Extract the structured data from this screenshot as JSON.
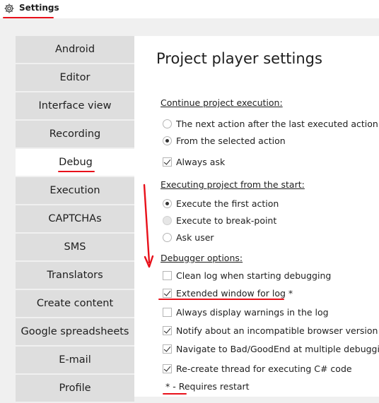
{
  "window": {
    "title": "Settings",
    "icon": "gear-icon"
  },
  "sidebar": {
    "items": [
      {
        "label": "Android"
      },
      {
        "label": "Editor"
      },
      {
        "label": "Interface view"
      },
      {
        "label": "Recording"
      },
      {
        "label": "Debug",
        "active": true
      },
      {
        "label": "Execution"
      },
      {
        "label": "CAPTCHAs"
      },
      {
        "label": "SMS"
      },
      {
        "label": "Translators"
      },
      {
        "label": "Create content"
      },
      {
        "label": "Google spreadsheets"
      },
      {
        "label": "E-mail"
      },
      {
        "label": "Profile"
      }
    ]
  },
  "main": {
    "title": "Project player settings",
    "continue": {
      "heading": "Continue project execution:",
      "options": [
        {
          "label": "The next action after the last executed action",
          "checked": false
        },
        {
          "label": "From the selected action",
          "checked": true
        }
      ],
      "always_ask": {
        "label": "Always ask",
        "checked": true
      }
    },
    "start": {
      "heading": "Executing project from the start:",
      "options": [
        {
          "label": "Execute the first action",
          "checked": true
        },
        {
          "label": "Execute to break-point",
          "checked": false,
          "disabled": true
        },
        {
          "label": "Ask user",
          "checked": false
        }
      ]
    },
    "debugger": {
      "heading": "Debugger options:",
      "options": [
        {
          "label": "Clean log when starting debugging",
          "checked": false
        },
        {
          "label": "Extended window for log *",
          "checked": true
        },
        {
          "label": "Always display warnings in the log",
          "checked": false
        },
        {
          "label": "Notify about an incompatible browser version",
          "checked": true
        },
        {
          "label": "Navigate to Bad/GoodEnd at multiple debugging",
          "checked": true
        },
        {
          "label": "Re-create thread for executing C# code",
          "checked": true
        }
      ]
    },
    "footnote": "* - Requires restart"
  },
  "colors": {
    "annotation": "#e8101a",
    "active_tab": "#ffffff",
    "tab": "#dedede",
    "panel": "#ffffff"
  }
}
